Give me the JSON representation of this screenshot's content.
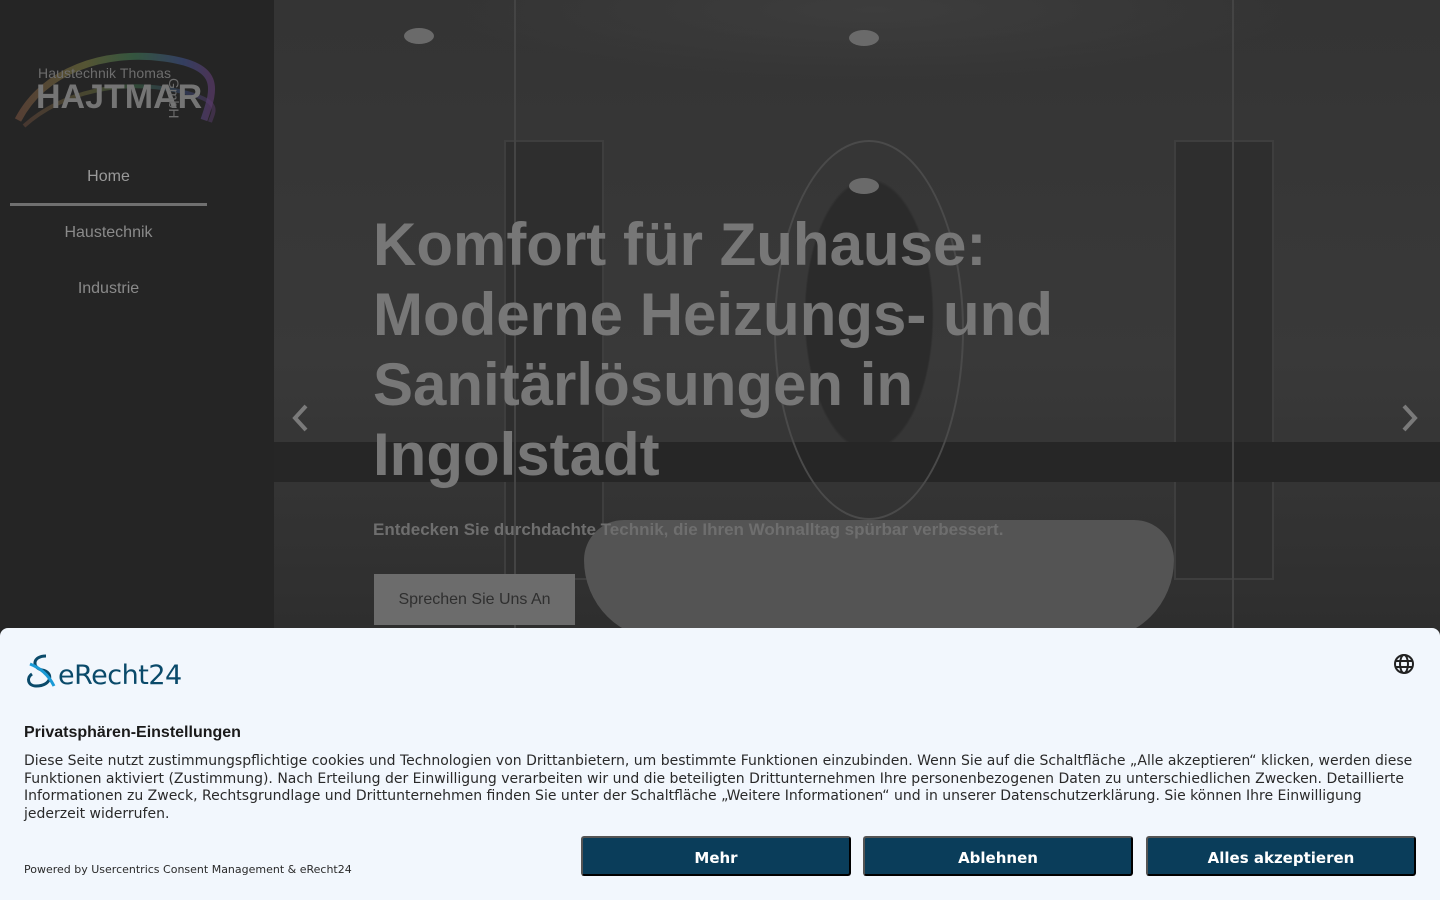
{
  "sidebar": {
    "logo": {
      "line1": "Haustechnik Thomas",
      "line2": "HAJTMAR",
      "suffix": "GmbH"
    },
    "nav": [
      {
        "label": "Home",
        "active": true
      },
      {
        "label": "Haustechnik",
        "active": false
      },
      {
        "label": "Industrie",
        "active": false
      }
    ]
  },
  "hero": {
    "title": "Komfort für Zuhause: Moderne Heizungs- und Sanitärlösungen in Ingolstadt",
    "subtitle": "Entdecken Sie durchdachte Technik, die Ihren Wohnalltag spürbar verbessert.",
    "cta_label": "Sprechen Sie Uns An",
    "prev_icon": "chevron-left-icon",
    "next_icon": "chevron-right-icon"
  },
  "consent": {
    "brand": "eRecht24",
    "title": "Privatsphären-Einstellungen",
    "text": "Diese Seite nutzt zustimmungspflichtige cookies und Technologien von Drittanbietern, um bestimmte Funktionen einzubinden. Wenn Sie auf die Schaltfläche „Alle akzeptieren“ klicken, werden diese Funktionen aktiviert (Zustimmung). Nach Erteilung der Einwilligung verarbeiten wir und die beteiligten Drittunternehmen Ihre personenbezogenen Daten zu unterschiedlichen Zwecken. Detaillierte Informationen zu Zweck, Rechtsgrundlage und Drittunternehmen finden Sie unter der Schaltfläche „Weitere Informationen“ und in unserer Datenschutzerklärung. Sie können Ihre Einwilligung jederzeit widerrufen.",
    "powered": "Powered by Usercentrics Consent Management & eRecht24",
    "buttons": {
      "more": "Mehr",
      "decline": "Ablehnen",
      "accept_all": "Alles akzeptieren"
    },
    "colors": {
      "button_bg": "#0a3d5a",
      "banner_bg": "#f2f7fd"
    }
  }
}
